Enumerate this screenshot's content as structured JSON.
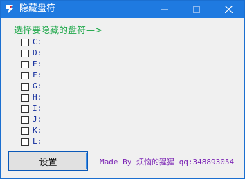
{
  "window": {
    "title": "隐藏盘符"
  },
  "main": {
    "prompt": "选择要隐藏的盘符—>",
    "drives": [
      {
        "label": "C:",
        "checked": false
      },
      {
        "label": "D:",
        "checked": false
      },
      {
        "label": "E:",
        "checked": false
      },
      {
        "label": "F:",
        "checked": false
      },
      {
        "label": "G:",
        "checked": false
      },
      {
        "label": "H:",
        "checked": false
      },
      {
        "label": "I:",
        "checked": false
      },
      {
        "label": "J:",
        "checked": false
      },
      {
        "label": "K:",
        "checked": false
      },
      {
        "label": "L:",
        "checked": false
      }
    ],
    "set_button_label": "设置",
    "footer_text": "Made By 烦恼的猩猩 qq:348893054"
  },
  "colors": {
    "titlebar": "#1f7ae0",
    "prompt": "#1fa84a",
    "drive_label": "#0f2a9c",
    "footer": "#7a22b4"
  },
  "icons": {
    "app": "app-icon",
    "minimize": "minimize-icon",
    "maximize": "maximize-icon",
    "close": "close-icon"
  }
}
